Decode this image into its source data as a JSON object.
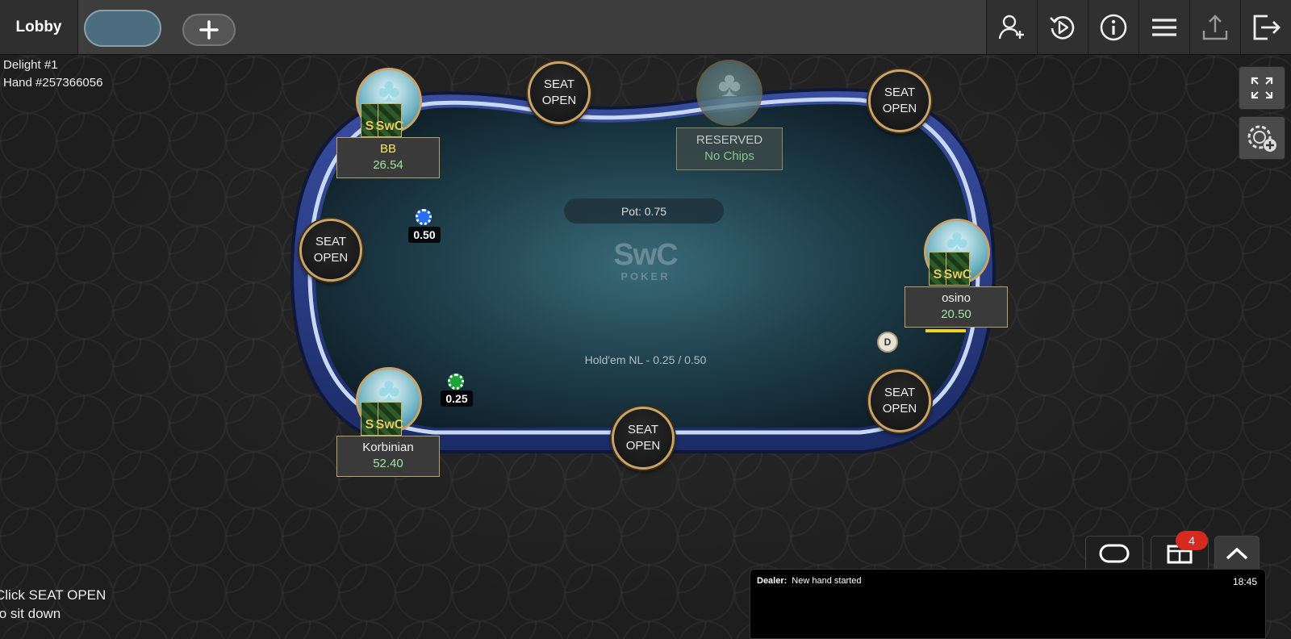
{
  "topbar": {
    "lobby_label": "Lobby",
    "tools": [
      {
        "icon": "add-user-icon"
      },
      {
        "icon": "replay-icon"
      },
      {
        "icon": "info-icon"
      },
      {
        "icon": "menu-icon"
      },
      {
        "icon": "share-icon"
      },
      {
        "icon": "exit-icon"
      }
    ]
  },
  "table_info": {
    "name": "Delight #1",
    "hand": "Hand #257366056"
  },
  "table": {
    "pot": "Pot: 0.75",
    "game": "Hold'em NL - 0.25 / 0.50",
    "logo_main": "SwC",
    "logo_sub": "POKER",
    "colors": {
      "felt_center": "#3a6a78",
      "felt_edge": "#0f1f28",
      "rail": "#243a7a",
      "rail_highlight": "#c8d8f0"
    }
  },
  "seat_open_label_1": "SEAT",
  "seat_open_label_2": "OPEN",
  "players": {
    "bb": {
      "name": "BB",
      "chips": "26.54",
      "card_text": "SwC",
      "card_text_short": "S"
    },
    "korbinian": {
      "name": "Korbinian",
      "chips": "52.40",
      "card_text": "SwC",
      "card_text_short": "S"
    },
    "osino": {
      "name": "osino",
      "chips": "20.50",
      "card_text": "SwC",
      "card_text_short": "S"
    }
  },
  "reserved": {
    "label": "RESERVED",
    "chips": "No Chips"
  },
  "bets": {
    "bb": {
      "amount": "0.50",
      "chip_color": "#2a6ef0"
    },
    "korbinian": {
      "amount": "0.25",
      "chip_color": "#1fa23a"
    }
  },
  "dealer_button": "D",
  "hint": {
    "line1": "Click SEAT OPEN",
    "line2": "to sit down"
  },
  "chat": {
    "unread": "4",
    "sender": "Dealer:",
    "message": "New hand started",
    "time": "18:45"
  }
}
